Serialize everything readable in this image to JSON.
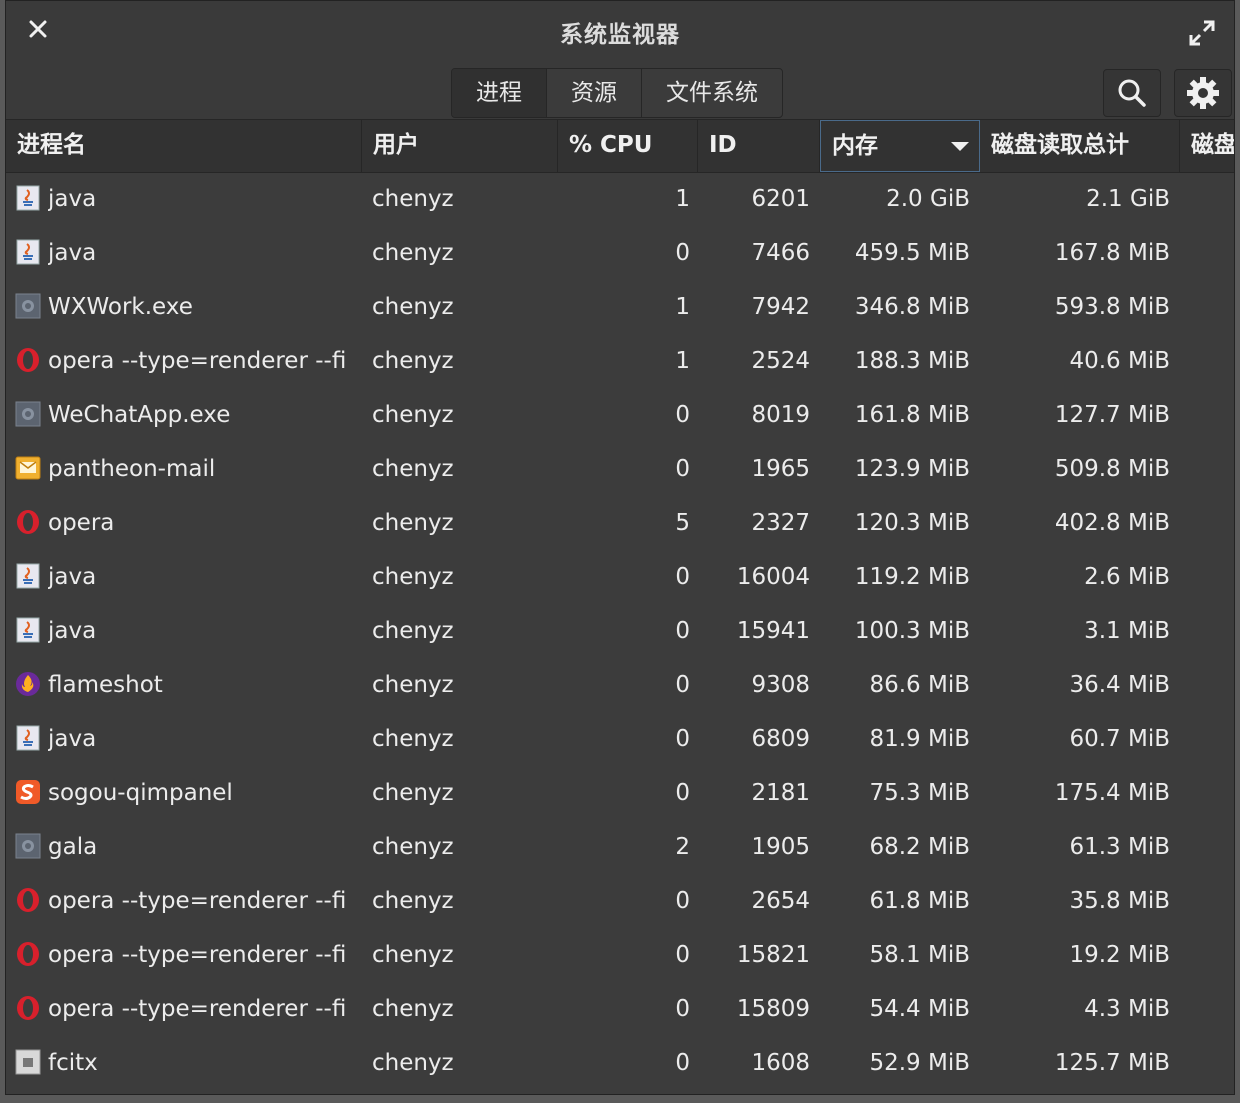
{
  "window": {
    "title": "系统监视器"
  },
  "tabs": [
    {
      "label": "进程"
    },
    {
      "label": "资源"
    },
    {
      "label": "文件系统"
    }
  ],
  "toolbar": {
    "search_icon": "search-icon",
    "settings_icon": "gear-icon"
  },
  "columns": {
    "name": "进程名",
    "user": "用户",
    "cpu": "% CPU",
    "id": "ID",
    "memory": "内存",
    "disk_read": "磁盘读取总计",
    "disk_extra": "磁盘"
  },
  "rows": [
    {
      "icon": "java",
      "name": "java",
      "user": "chenyz",
      "cpu": "1",
      "id": "6201",
      "mem": "2.0 GiB",
      "disk": "2.1 GiB"
    },
    {
      "icon": "java",
      "name": "java",
      "user": "chenyz",
      "cpu": "0",
      "id": "7466",
      "mem": "459.5 MiB",
      "disk": "167.8 MiB"
    },
    {
      "icon": "exe",
      "name": "WXWork.exe",
      "user": "chenyz",
      "cpu": "1",
      "id": "7942",
      "mem": "346.8 MiB",
      "disk": "593.8 MiB"
    },
    {
      "icon": "opera",
      "name": "opera --type=renderer --fi",
      "user": "chenyz",
      "cpu": "1",
      "id": "2524",
      "mem": "188.3 MiB",
      "disk": "40.6 MiB"
    },
    {
      "icon": "exe",
      "name": "WeChatApp.exe",
      "user": "chenyz",
      "cpu": "0",
      "id": "8019",
      "mem": "161.8 MiB",
      "disk": "127.7 MiB"
    },
    {
      "icon": "mail",
      "name": "pantheon-mail",
      "user": "chenyz",
      "cpu": "0",
      "id": "1965",
      "mem": "123.9 MiB",
      "disk": "509.8 MiB"
    },
    {
      "icon": "opera",
      "name": "opera",
      "user": "chenyz",
      "cpu": "5",
      "id": "2327",
      "mem": "120.3 MiB",
      "disk": "402.8 MiB"
    },
    {
      "icon": "java",
      "name": "java",
      "user": "chenyz",
      "cpu": "0",
      "id": "16004",
      "mem": "119.2 MiB",
      "disk": "2.6 MiB"
    },
    {
      "icon": "java",
      "name": "java",
      "user": "chenyz",
      "cpu": "0",
      "id": "15941",
      "mem": "100.3 MiB",
      "disk": "3.1 MiB"
    },
    {
      "icon": "flameshot",
      "name": "flameshot",
      "user": "chenyz",
      "cpu": "0",
      "id": "9308",
      "mem": "86.6 MiB",
      "disk": "36.4 MiB"
    },
    {
      "icon": "java",
      "name": "java",
      "user": "chenyz",
      "cpu": "0",
      "id": "6809",
      "mem": "81.9 MiB",
      "disk": "60.7 MiB"
    },
    {
      "icon": "sogou",
      "name": "sogou-qimpanel",
      "user": "chenyz",
      "cpu": "0",
      "id": "2181",
      "mem": "75.3 MiB",
      "disk": "175.4 MiB"
    },
    {
      "icon": "exe",
      "name": "gala",
      "user": "chenyz",
      "cpu": "2",
      "id": "1905",
      "mem": "68.2 MiB",
      "disk": "61.3 MiB"
    },
    {
      "icon": "opera",
      "name": "opera --type=renderer --fi",
      "user": "chenyz",
      "cpu": "0",
      "id": "2654",
      "mem": "61.8 MiB",
      "disk": "35.8 MiB"
    },
    {
      "icon": "opera",
      "name": "opera --type=renderer --fi",
      "user": "chenyz",
      "cpu": "0",
      "id": "15821",
      "mem": "58.1 MiB",
      "disk": "19.2 MiB"
    },
    {
      "icon": "opera",
      "name": "opera --type=renderer --fi",
      "user": "chenyz",
      "cpu": "0",
      "id": "15809",
      "mem": "54.4 MiB",
      "disk": "4.3 MiB"
    },
    {
      "icon": "generic",
      "name": "fcitx",
      "user": "chenyz",
      "cpu": "0",
      "id": "1608",
      "mem": "52.9 MiB",
      "disk": "125.7 MiB"
    }
  ]
}
